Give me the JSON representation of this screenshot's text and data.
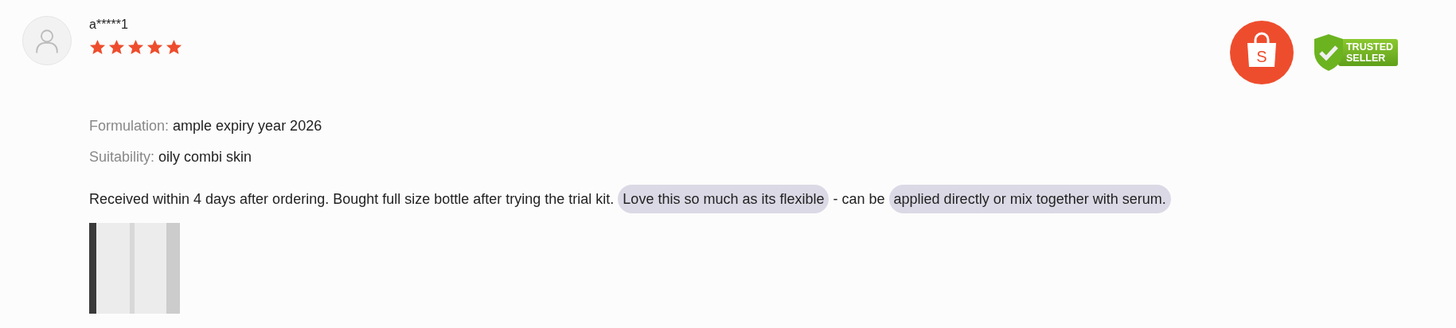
{
  "review": {
    "username": "a*****1",
    "stars": 5,
    "badges": [
      {
        "kind": "shop",
        "letter": "S"
      },
      {
        "kind": "trusted",
        "line_1": "TRUSTED",
        "line_2": "SELLER"
      }
    ],
    "attributes": [
      {
        "label": "Formulation:",
        "value": "ample expiry year 2026"
      },
      {
        "label": "Suitability:",
        "value": "oily combi skin"
      }
    ],
    "text_segments": [
      {
        "text": "Received within 4 days after ordering. Bought full size bottle after trying the trial kit.",
        "highlighted": false
      },
      {
        "text": "Love this so much as its flexible",
        "highlighted": true
      },
      {
        "text": "- can be",
        "highlighted": false
      },
      {
        "text": "applied directly or mix together with serum.",
        "highlighted": true
      }
    ],
    "photos": [
      {
        "kind": "photo"
      }
    ]
  }
}
